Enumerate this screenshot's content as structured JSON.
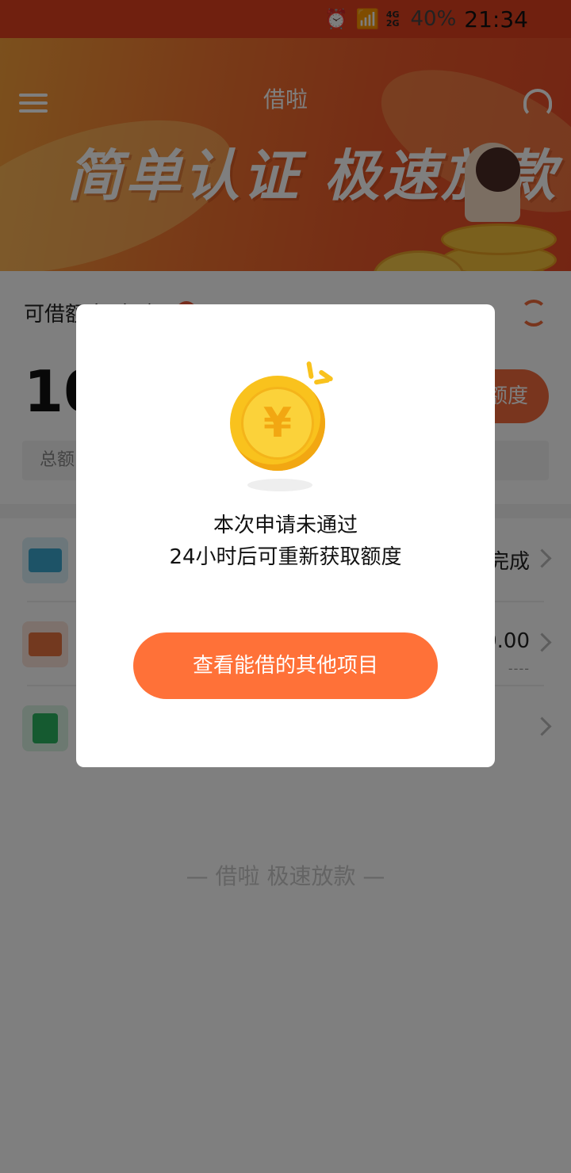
{
  "status_bar": {
    "battery": "40%",
    "time": "21:34",
    "network_top": "4G",
    "network_bottom": "2G"
  },
  "header": {
    "title": "借啦",
    "banner_slogan": "简单认证 极速放款"
  },
  "quota_card": {
    "label": "可借额度（元）",
    "amount": "10",
    "get_button": "额度",
    "total_label": "总额"
  },
  "list": {
    "items": [
      {
        "icon": "id-card-icon",
        "value": "完成"
      },
      {
        "icon": "bank-card-icon",
        "value": "0.00",
        "sub": "----"
      },
      {
        "icon": "clipboard-icon",
        "value": ""
      }
    ]
  },
  "footer": {
    "slogan": "— 借啦  极速放款 —"
  },
  "dialog": {
    "message_line1": "本次申请未通过",
    "message_line2": "24小时后可重新获取额度",
    "cta_label": "查看能借的其他项目"
  },
  "colors": {
    "primary": "#ff7138",
    "banner": "#ec5a2a",
    "coin": "#f9c21d"
  }
}
